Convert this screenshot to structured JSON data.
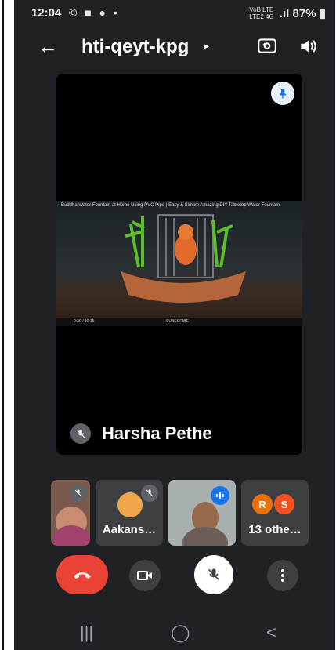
{
  "status": {
    "time": "12:04",
    "notif_icons": "© ■ ● •",
    "net_label_top": "VoB LTE",
    "net_label_bottom": "LTE2 4G",
    "battery": "87%"
  },
  "header": {
    "back_icon": "arrow-back-icon",
    "meeting_code": "hti-qeyt-kpg",
    "chevron": "▸",
    "switch_camera_icon": "camera-switch-icon",
    "audio_icon": "speaker-icon"
  },
  "stage": {
    "speaker_name": "Harsha Pethe",
    "video_caption": "Buddha Water Fountain at Home Using PVC Pipe | Easy & Simple Amazing DIY Tabletop Water Fountain",
    "video_time": "0:30 / 10:15",
    "video_mid": "SUBSCRIBE"
  },
  "tiles": [
    {
      "label": "",
      "muted": true
    },
    {
      "label": "Aakans…",
      "muted": true
    },
    {
      "label": "",
      "speaking": true
    },
    {
      "label": "13 othe…",
      "avatars": [
        "R",
        "S"
      ]
    }
  ],
  "colors": {
    "background": "#202124",
    "end_call": "#ea4335",
    "speaking": "#1a73e8",
    "avatar_r": "#e8710a",
    "avatar_s": "#f4511e"
  },
  "nav": {
    "recents": "|||",
    "home": "◯",
    "back": "<"
  }
}
